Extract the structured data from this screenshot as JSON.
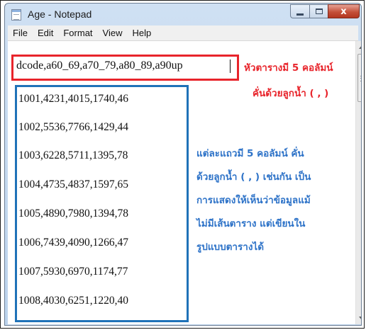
{
  "window": {
    "title": "Age - Notepad",
    "close_glyph": "x"
  },
  "menu": [
    "File",
    "Edit",
    "Format",
    "View",
    "Help"
  ],
  "editor": {
    "header": "dcode,a60_69,a70_79,a80_89,a90up",
    "rows": [
      "1001,4231,4015,1740,46",
      "1002,5536,7766,1429,44",
      "1003,6228,5711,1395,78",
      "1004,4735,4837,1597,65",
      "1005,4890,7980,1394,78",
      "1006,7439,4090,1266,47",
      "1007,5930,6970,1174,77",
      "1008,4030,6251,1220,40"
    ]
  },
  "annotations": {
    "header_note": [
      "หัวตารางมี 5 คอลัมน์",
      "คั่นด้วยลูกน้ำ ( , )"
    ],
    "rows_note": [
      "แต่ละแถวมี 5 คอลัมน์ คั่น",
      "ด้วยลูกน้ำ ( , ) เช่นกัน  เป็น",
      "การแสดงให้เห็นว่าข้อมูลแม้",
      "ไม่มีเส้นตาราง แต่เขียนใน",
      "รูปแบบตารางได้"
    ]
  },
  "colors": {
    "header_box": "#e8242b",
    "rows_box": "#1f72b8",
    "rows_note_text": "#2e73c8"
  },
  "icons": {
    "app": "notepad-icon",
    "minimize": "minimize-icon",
    "maximize": "maximize-icon",
    "close": "close-icon",
    "scroll_up": "arrow-up-icon",
    "scroll_down": "arrow-down-icon"
  }
}
